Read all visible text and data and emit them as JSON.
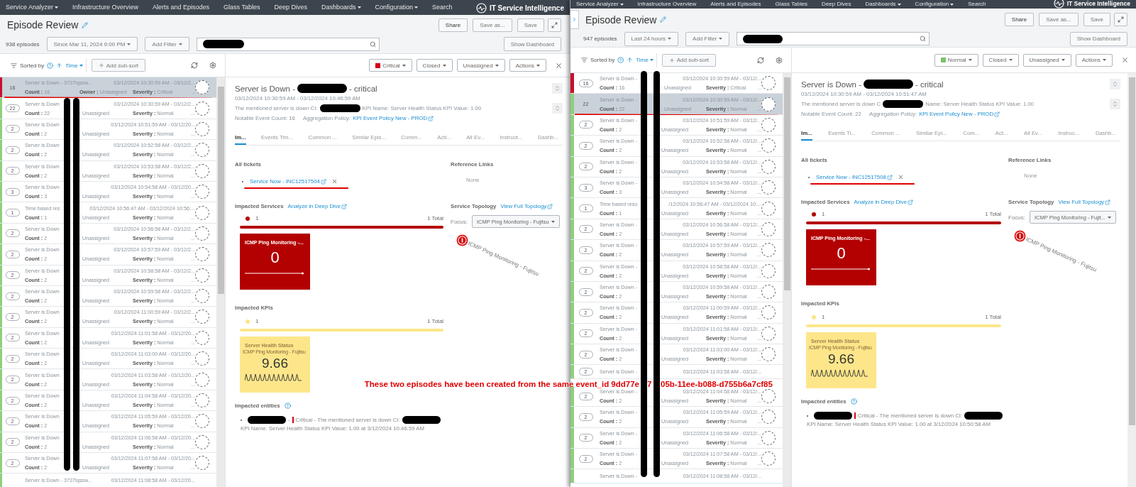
{
  "windows": [
    {
      "kind": "back",
      "nav": {
        "items": [
          {
            "label": "Service Analyzer",
            "dropdown": true
          },
          {
            "label": "Infrastructure Overview",
            "dropdown": false
          },
          {
            "label": "Alerts and Episodes",
            "dropdown": false
          },
          {
            "label": "Glass Tables",
            "dropdown": false
          },
          {
            "label": "Deep Dives",
            "dropdown": false
          },
          {
            "label": "Dashboards",
            "dropdown": true
          },
          {
            "label": "Configuration",
            "dropdown": true
          },
          {
            "label": "Search",
            "dropdown": false
          }
        ],
        "product": "IT Service Intelligence"
      },
      "page_title": "Episode Review",
      "actions": [
        "Share",
        "Save as...",
        "Save"
      ],
      "episode_count": "938 episodes",
      "time_range": "Since Mar 11, 2024 9:00 PM",
      "add_filter": "Add Filter",
      "show_dashboard": "Show Dashboard",
      "sort": {
        "label": "Sorted by",
        "field": "Time",
        "add_sub_sort": "Add sub-sort"
      },
      "episodes": [
        {
          "badge": "16",
          "title": "Server is Down - 3737lqssw...",
          "time": "03/12/2024 10:30:59 AM - 03/12/2...",
          "count": "**Count :** 16",
          "owner": "**Owner :** Unassigned",
          "severity": "**Severity :** Critical",
          "more": "...",
          "color": "#c8102e",
          "selected": true,
          "underlined": true
        },
        {
          "badge": "22",
          "title": "Server is Down",
          "time": "03/12/2024 10:30:59 AM - 03/12/2...",
          "count": "**Count :** 22",
          "owner": ": Unassigned",
          "severity": "**Severity :** Normal",
          "more": "...",
          "color": "#8fcf7a",
          "selected": false,
          "underlined": false
        },
        {
          "badge": "2",
          "title": "Server is Down",
          "time": "03/12/2024 10:51:59 AM - 03/12/20...",
          "count": "**Count :** 2",
          "owner": ": Unassigned",
          "severity": "**Severity :** Normal",
          "more": "...",
          "color": "#8fcf7a",
          "selected": false,
          "underlined": false
        },
        {
          "badge": "2",
          "title": "Server is Down",
          "time": "03/12/2024 10:52:58 AM - 03/12/2...",
          "count": "**Count :** 2",
          "owner": ": Unassigned",
          "severity": "**Severity :** Normal",
          "more": "...",
          "color": "#8fcf7a",
          "selected": false,
          "underlined": false
        },
        {
          "badge": "2",
          "title": "Server is Down",
          "time": "03/12/2024 10:53:58 AM - 03/12/2...",
          "count": "**Count :** 2",
          "owner": ": Unassigned",
          "severity": "**Severity :** Normal",
          "more": "...",
          "color": "#8fcf7a",
          "selected": false,
          "underlined": false
        },
        {
          "badge": "3",
          "title": "Server is Down",
          "time": "03/12/2024 10:54:58 AM - 03/12/20...",
          "count": "**Count :** 3",
          "owner": ": Unassigned",
          "severity": "**Severity :** Normal",
          "more": "...",
          "color": "#8fcf7a",
          "selected": false,
          "underlined": false
        },
        {
          "badge": "1",
          "title": "Time based res",
          "time": "03/12/2024 10:56:47 AM - 03/12/2024 10:56:...",
          "count": "**Count :** 1",
          "owner": ": Unassigned",
          "severity": "**Severity :** Normal",
          "more": "...",
          "color": "#8fcf7a",
          "selected": false,
          "underlined": false
        },
        {
          "badge": "2",
          "title": "Server is Down",
          "time": "03/12/2024 10:56:58 AM - 03/12/2...",
          "count": "**Count :** 2",
          "owner": ": Unassigned",
          "severity": "**Severity :** Normal",
          "more": "...",
          "color": "#8fcf7a",
          "selected": false,
          "underlined": false
        },
        {
          "badge": "2",
          "title": "Server is Down",
          "time": "03/12/2024 10:57:59 AM - 03/12/2...",
          "count": "**Count :** 2",
          "owner": ": Unassigned",
          "severity": "**Severity :** Normal",
          "more": "...",
          "color": "#8fcf7a",
          "selected": false,
          "underlined": false
        },
        {
          "badge": "2",
          "title": "Server is Down",
          "time": "03/12/2024 10:58:58 AM - 03/12/2...",
          "count": "**Count :** 2",
          "owner": ": Unassigned",
          "severity": "**Severity :** Normal",
          "more": "...",
          "color": "#8fcf7a",
          "selected": false,
          "underlined": false
        },
        {
          "badge": "2",
          "title": "Server is Down",
          "time": "03/12/2024 10:59:58 AM - 03/12/2...",
          "count": "**Count :** 2",
          "owner": ": Unassigned",
          "severity": "**Severity :** Normal",
          "more": "...",
          "color": "#8fcf7a",
          "selected": false,
          "underlined": false
        },
        {
          "badge": "2",
          "title": "Server is Down",
          "time": "03/12/2024 11:00:59 AM - 03/12/2...",
          "count": "**Count :** 2",
          "owner": ": Unassigned",
          "severity": "**Severity :** Normal",
          "more": "...",
          "color": "#8fcf7a",
          "selected": false,
          "underlined": false
        },
        {
          "badge": "2",
          "title": "Server is Down",
          "time": "03/12/2024 11:01:58 AM - 03/12/20...",
          "count": "**Count :** 2",
          "owner": ": Unassigned",
          "severity": "**Severity :** Normal",
          "more": "...",
          "color": "#8fcf7a",
          "selected": false,
          "underlined": false
        },
        {
          "badge": "2",
          "title": "Server is Down",
          "time": "03/12/2024 11:03:00 AM - 03/12/20...",
          "count": "**Count :** 2",
          "owner": ": Unassigned",
          "severity": "**Severity :** Normal",
          "more": "...",
          "color": "#8fcf7a",
          "selected": false,
          "underlined": false
        },
        {
          "badge": "2",
          "title": "Server is Down",
          "time": "03/12/2024 11:03:58 AM - 03/12/20...",
          "count": "**Count :** 2",
          "owner": ": Unassigned",
          "severity": "**Severity :** Normal",
          "more": "...",
          "color": "#8fcf7a",
          "selected": false,
          "underlined": false
        },
        {
          "badge": "2",
          "title": "Server is Down",
          "time": "03/12/2024 11:04:58 AM - 03/12/20...",
          "count": "**Count :** 2",
          "owner": ": Unassigned",
          "severity": "**Severity :** Normal",
          "more": "...",
          "color": "#8fcf7a",
          "selected": false,
          "underlined": false
        },
        {
          "badge": "2",
          "title": "Server is Down",
          "time": "03/12/2024 11:05:59 AM - 03/12/20...",
          "count": "**Count :** 2",
          "owner": ": Unassigned",
          "severity": "**Severity :** Normal",
          "more": "...",
          "color": "#8fcf7a",
          "selected": false,
          "underlined": false
        },
        {
          "badge": "2",
          "title": "Server is Down",
          "time": "03/12/2024 11:06:58 AM - 03/12/20...",
          "count": "**Count :** 2",
          "owner": ": Unassigned",
          "severity": "**Severity :** Normal",
          "more": "...",
          "color": "#8fcf7a",
          "selected": false,
          "underlined": false
        },
        {
          "badge": "2",
          "title": "Server is Down",
          "time": "03/12/2024 11:07:58 AM - 03/12/20...",
          "count": "**Count :** 2",
          "owner": ": Unassigned",
          "severity": "**Severity :** Normal",
          "more": "...",
          "color": "#8fcf7a",
          "selected": false,
          "underlined": false
        },
        {
          "title": "Server is Down - 3737lqssw...",
          "time": "03/12/2024 11:08:58 AM - 03/12/20...",
          "color": "#8fcf7a",
          "selected": false,
          "underlined": false
        }
      ],
      "detail": {
        "severity": {
          "label": "Critical",
          "color": "#d0021b"
        },
        "status": "Closed",
        "owner": "Unassigned",
        "actions": "Actions",
        "title": [
          {
            "kind": "text",
            "text": "Server is Down -"
          },
          {
            "kind": "redacted"
          },
          {
            "kind": "text",
            "text": "- critical"
          }
        ],
        "dates": "03/12/2024 10:30:59 AM - 03/12/2024 10:46:59 AM",
        "description": [
          {
            "kind": "text",
            "text": "The mentioned server is down CI:"
          },
          {
            "kind": "redacted"
          },
          {
            "kind": "text",
            "text": "KPI Name: Server Health Status KPI Value: 1.00"
          }
        ],
        "notable_count": "Notable Event Count: 16",
        "policy_label": "Aggregation Policy:",
        "policy_link": "KPI Event Policy New - PROD",
        "tabs": [
          {
            "label": "Im...",
            "selected": true
          },
          {
            "label": "Events Tim...",
            "selected": false
          },
          {
            "label": "Common ...",
            "selected": false
          },
          {
            "label": "Similar Epis...",
            "selected": false
          },
          {
            "label": "Comm...",
            "selected": false
          },
          {
            "label": "Acti...",
            "selected": false
          },
          {
            "label": "All Ev...",
            "selected": false
          },
          {
            "label": "Instruct...",
            "selected": false
          },
          {
            "label": "Dashb...",
            "selected": false
          }
        ],
        "tickets": {
          "heading": "All tickets",
          "items": [
            "Service Now - INC12517504"
          ]
        },
        "references": {
          "heading": "Reference Links",
          "value": "None"
        },
        "services": {
          "heading": "Impacted Services",
          "link": "Analyze in Deep Dive",
          "count": "1",
          "total": "1 Total",
          "color": "#b30000",
          "tile": {
            "title": "ICMP Ping Monitoring -...",
            "value": "0"
          }
        },
        "topology": {
          "heading": "Service Topology",
          "link": "View Full Topology",
          "focus_label": "Focus:",
          "focus_value": "ICMP Ping Monitoring - Fujitsu",
          "node_label": "ICMP Ping Monitoring - Fujitsu"
        },
        "kpis": {
          "heading": "Impacted KPIs",
          "count": "1",
          "total": "1 Total",
          "color": "#fde68a",
          "tile": {
            "title": "Server Health Status",
            "subtitle": "ICMP Ping Monitoring - Fujitsu",
            "value": "9.66"
          }
        },
        "entities": {
          "heading": "Impacted entities",
          "items": [
            {
              "segments": [
                {
                  "kind": "redacted"
                },
                {
                  "kind": "text",
                  "text": "-"
                },
                {
                  "kind": "marker"
                },
                {
                  "kind": "text",
                  "text": "Critical - The mentioned server is down CI:"
                },
                {
                  "kind": "redacted"
                },
                {
                  "kind": "text",
                  "text": "KPI Name: Server Health Status KPI Value: 1.00 at 3/12/2024 10:46:59 AM"
                }
              ]
            }
          ]
        }
      }
    },
    {
      "kind": "front",
      "nav": {
        "items": [
          {
            "label": "Service Analyzer",
            "dropdown": true
          },
          {
            "label": "Infrastructure Overview",
            "dropdown": false
          },
          {
            "label": "Alerts and Episodes",
            "dropdown": false
          },
          {
            "label": "Glass Tables",
            "dropdown": false
          },
          {
            "label": "Deep Dives",
            "dropdown": false
          },
          {
            "label": "Dashboards",
            "dropdown": true
          },
          {
            "label": "Configuration",
            "dropdown": true
          },
          {
            "label": "Search",
            "dropdown": false
          }
        ],
        "product": "IT Service Intelligence"
      },
      "page_title": "Episode Review",
      "actions": [
        "Share",
        "Save as...",
        "Save"
      ],
      "episode_count": "947 episodes",
      "time_range": "Last 24 hours",
      "add_filter": "Add Filter",
      "show_dashboard": "Show Dashboard",
      "sort": {
        "label": "Sorted by",
        "field": "Time",
        "add_sub_sort": "Add sub-sort"
      },
      "episodes": [
        {
          "badge": "16",
          "title": "Server is Down -",
          "time": "03/12/2024 10:30:59 AM - 03/12/...",
          "count": "**Count :** 16",
          "owner": ": Unassigned",
          "severity": "**Severity :** Critical",
          "more": "...",
          "color": "#c8102e",
          "selected": false,
          "underlined": false
        },
        {
          "badge": "22",
          "title": "Server is Down -",
          "time": "03/12/2024 10:30:59 AM - 03/12/...",
          "count": "**Count :** 22",
          "owner": ": Unassigned",
          "severity": "**Severity :** Normal",
          "more": "...",
          "color": "#8fcf7a",
          "selected": true,
          "underlined": true
        },
        {
          "badge": "2",
          "title": "Server is Down -",
          "time": "03/12/2024 10:51:59 AM - 03/12/...",
          "count": "**Count :** 2",
          "owner": "Unassigned",
          "severity": "**Severity :** Normal",
          "more": "...",
          "color": "#8fcf7a",
          "selected": false,
          "underlined": false
        },
        {
          "badge": "2",
          "title": "Server is Down -",
          "time": "03/12/2024 10:52:58 AM - 03/12/...",
          "count": "**Count :** 2",
          "owner": "Unassigned",
          "severity": "**Severity :** Normal",
          "more": "...",
          "color": "#8fcf7a",
          "selected": false,
          "underlined": false
        },
        {
          "badge": "2",
          "title": "Server is Down -",
          "time": "03/12/2024 10:53:58 AM - 03/12/...",
          "count": "**Count :** 2",
          "owner": "Unassigned",
          "severity": "**Severity :** Normal",
          "more": "...",
          "color": "#8fcf7a",
          "selected": false,
          "underlined": false
        },
        {
          "badge": "3",
          "title": "Server is Down -",
          "time": "03/12/2024 10:54:58 AM - 03/12/...",
          "count": "**Count :** 3",
          "owner": "Unassigned",
          "severity": "**Severity :** Normal",
          "more": "...",
          "color": "#8fcf7a",
          "selected": false,
          "underlined": false
        },
        {
          "badge": "1",
          "title": "Time based reso",
          "time": "/12/2024 10:56:47 AM - 03/12/2024 10:...",
          "count": "**Count :** 1",
          "owner": "Unassigned",
          "severity": "**Severity :** Normal",
          "more": "...",
          "color": "#8fcf7a",
          "selected": false,
          "underlined": false
        },
        {
          "badge": "2",
          "title": "Server is Down -",
          "time": "03/12/2024 10:56:58 AM - 03/12/...",
          "count": "**Count :** 2",
          "owner": "Unassigned",
          "severity": "**Severity :** Normal",
          "more": "...",
          "color": "#8fcf7a",
          "selected": false,
          "underlined": false
        },
        {
          "badge": "2",
          "title": "Server is Down -",
          "time": "03/12/2024 10:57:59 AM - 03/12/...",
          "count": "**Count :** 2",
          "owner": "Unassigned",
          "severity": "**Severity :** Normal",
          "more": "...",
          "color": "#8fcf7a",
          "selected": false,
          "underlined": false
        },
        {
          "badge": "2",
          "title": "Server is Down -",
          "time": "03/12/2024 10:58:58 AM - 03/12/...",
          "count": "**Count :** 2",
          "owner": "Unassigned",
          "severity": "**Severity :** Normal",
          "more": "...",
          "color": "#8fcf7a",
          "selected": false,
          "underlined": false
        },
        {
          "badge": "2",
          "title": "Server is Down -",
          "time": "03/12/2024 10:59:58 AM - 03/12/...",
          "count": "**Count :** 2",
          "owner": "Unassigned",
          "severity": "**Severity :** Normal",
          "more": "...",
          "color": "#8fcf7a",
          "selected": false,
          "underlined": false
        },
        {
          "badge": "2",
          "title": "Server is Down -",
          "time": "03/12/2024 11:00:59 AM - 03/12/...",
          "count": "**Count :** 2",
          "owner": "Unassigned",
          "severity": "**Severity :** Normal",
          "more": "...",
          "color": "#8fcf7a",
          "selected": false,
          "underlined": false
        },
        {
          "badge": "2",
          "title": "Server is Down -",
          "time": "03/12/2024 11:01:58 AM - 03/12/...",
          "count": "**Count :** 2",
          "owner": "Unassigned",
          "severity": "**Severity :** Normal",
          "more": "...",
          "color": "#8fcf7a",
          "selected": false,
          "underlined": false
        },
        {
          "badge": "2",
          "title": "Server is Down -",
          "time": "03/12/2024 11:03:00 AM - 03/12/...",
          "count": "**Count :** 2",
          "owner": "Unassigned",
          "severity": "**Severity :** Normal",
          "more": "...",
          "color": "#8fcf7a",
          "selected": false,
          "underlined": false
        },
        {
          "badge": "2",
          "title": "Server is Down -",
          "time": "03/12/2024 11:03:58 AM - 03/12/...",
          "color": "#8fcf7a",
          "selected": false,
          "underlined": false
        },
        {
          "badge": "2",
          "title": "Server is Down -",
          "time": "03/12/2024 11:04:58 AM - 03/12/...",
          "count": "**Count :** 2",
          "owner": "Unassigned",
          "severity": "**Severity :** Normal",
          "more": "...",
          "color": "#8fcf7a",
          "selected": false,
          "underlined": false
        },
        {
          "badge": "2",
          "title": "Server is Down -",
          "time": "03/12/2024 11:05:59 AM - 03/12/...",
          "count": "**Count :** 2",
          "owner": "Unassigned",
          "severity": "**Severity :** Normal",
          "more": "...",
          "color": "#8fcf7a",
          "selected": false,
          "underlined": false
        },
        {
          "badge": "2",
          "title": "Server is Down -",
          "time": "03/12/2024 11:06:58 AM - 03/12/...",
          "count": "**Count :** 2",
          "owner": "Unassigned",
          "severity": "**Severity :** Normal",
          "more": "...",
          "color": "#8fcf7a",
          "selected": false,
          "underlined": false
        },
        {
          "badge": "2",
          "title": "Server is Down -",
          "time": "03/12/2024 11:07:58 AM - 03/12/...",
          "count": "**Count :** 2",
          "owner": "Unassigned",
          "severity": "**Severity :** Normal",
          "more": "...",
          "color": "#8fcf7a",
          "selected": false,
          "underlined": false
        },
        {
          "title": "Server is Down -",
          "time": "03/12/2024 11:08:58 AM - 03/12/...",
          "color": "#8fcf7a",
          "selected": false,
          "underlined": false
        }
      ],
      "detail": {
        "severity": {
          "label": "Normal",
          "color": "#7ac26b"
        },
        "status": "Closed",
        "owner": "Unassigned",
        "actions": "Actions",
        "title": [
          {
            "kind": "text",
            "text": "Server is Down -"
          },
          {
            "kind": "redacted"
          },
          {
            "kind": "text",
            "text": "- critical"
          }
        ],
        "dates": "03/12/2024 10:30:59 AM - 03/12/2024 10:51:47 AM",
        "description": [
          {
            "kind": "text",
            "text": "The mentioned server is down C"
          },
          {
            "kind": "redacted"
          },
          {
            "kind": "text",
            "text": "Name: Server Health Status KPI Value: 1.00"
          }
        ],
        "notable_count": "Notable Event Count: 22",
        "policy_label": "Aggregation Policy:",
        "policy_link": "KPI Event Policy New - PROD",
        "tabs": [
          {
            "label": "Im...",
            "selected": true
          },
          {
            "label": "Events Ti...",
            "selected": false
          },
          {
            "label": "Common ...",
            "selected": false
          },
          {
            "label": "Similar Epi...",
            "selected": false
          },
          {
            "label": "Com...",
            "selected": false
          },
          {
            "label": "Act...",
            "selected": false
          },
          {
            "label": "All Ev...",
            "selected": false
          },
          {
            "label": "Instruc...",
            "selected": false
          },
          {
            "label": "Dashb...",
            "selected": false
          }
        ],
        "tickets": {
          "heading": "All tickets",
          "items": [
            "Service Now - INC12517508"
          ]
        },
        "references": {
          "heading": "Reference Links",
          "value": "None"
        },
        "services": {
          "heading": "Impacted Services",
          "link": "Analyze in Deep Dive",
          "count": "1",
          "total": "1 Total",
          "color": "#b30000",
          "tile": {
            "title": "ICMP Ping Monitoring -...",
            "value": "0"
          }
        },
        "topology": {
          "heading": "Service Topology",
          "link": "View Full Topology",
          "focus_label": "Focus:",
          "focus_value": "ICMP Ping Monitoring - Fujit...",
          "node_label": "ICMP Ping Monitoring - Fujitsu"
        },
        "kpis": {
          "heading": "Impacted KPIs",
          "count": "1",
          "total": "1 Total",
          "color": "#fde68a",
          "tile": {
            "title": "Server Health Status",
            "subtitle": "ICMP Ping Monitoring - Fujitsu",
            "value": "9.66"
          }
        },
        "entities": {
          "heading": "Impacted entities",
          "items": [
            {
              "segments": [
                {
                  "kind": "redacted"
                },
                {
                  "kind": "marker"
                },
                {
                  "kind": "text",
                  "text": "Critical - The mentioned server is down CI:"
                },
                {
                  "kind": "redacted"
                },
                {
                  "kind": "text",
                  "text": "KPI Name: Server Health Status KPI Value: 1.00 at 3/12/2024 10:50:58 AM"
                }
              ]
            }
          ]
        }
      }
    }
  ],
  "annotation": {
    "parts": [
      "These two episodes have been created from the same event_id 9dd77e",
      "7",
      "05b-11ee-b088-d755b6a7cf85"
    ]
  }
}
